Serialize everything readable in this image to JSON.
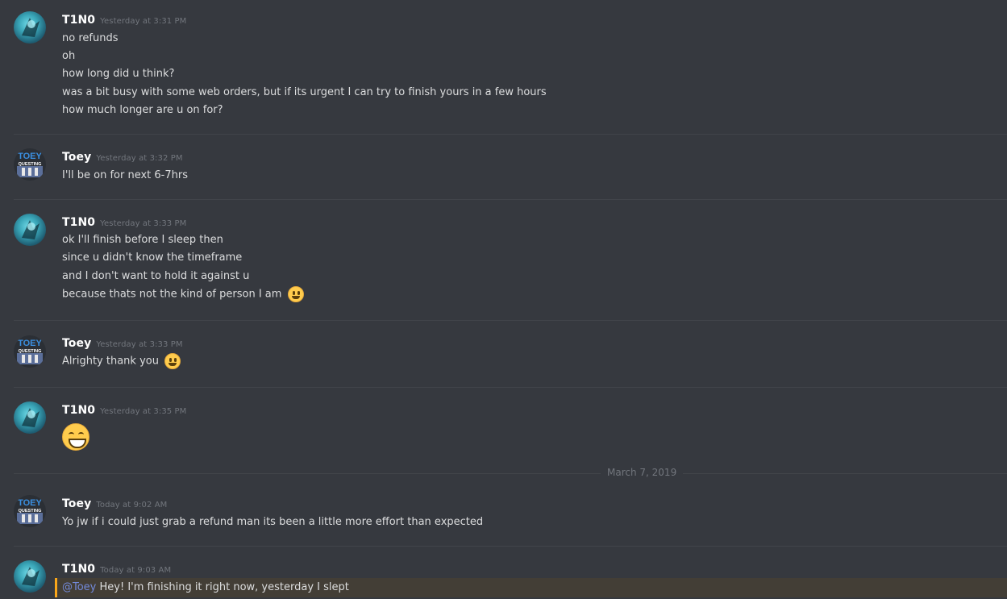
{
  "messages": [
    {
      "author": "T1N0",
      "timestamp": "Yesterday at 3:31 PM",
      "lines": [
        "no refunds",
        "oh",
        "how long did u think?",
        "was a bit busy with some web orders, but if its urgent I can try to finish yours in a few hours",
        "how much longer are u on for?"
      ]
    },
    {
      "author": "Toey",
      "timestamp": "Yesterday at 3:32 PM",
      "lines": [
        "I'll be on for next 6-7hrs"
      ]
    },
    {
      "author": "T1N0",
      "timestamp": "Yesterday at 3:33 PM",
      "lines": [
        "ok I'll finish before I sleep then",
        "since u didn't know the timeframe",
        "and I don't want to hold it against u",
        "because thats not the kind of person I am"
      ],
      "last_line_emoji": "smiley-emoji"
    },
    {
      "author": "Toey",
      "timestamp": "Yesterday at 3:33 PM",
      "lines": [
        "Alrighty thank you"
      ],
      "last_line_emoji": "smiley-emoji"
    },
    {
      "author": "T1N0",
      "timestamp": "Yesterday at 3:35 PM",
      "emoji_only": "grin-emoji"
    },
    {
      "author": "Toey",
      "timestamp": "Today at 9:02 AM",
      "lines": [
        "Yo jw if i could just grab a refund man its been a little more effort than expected"
      ]
    },
    {
      "author": "T1N0",
      "timestamp": "Today at 9:03 AM",
      "mention": "@Toey",
      "mention_text": " Hey! I'm finishing it right now, yesterday I slept"
    }
  ],
  "date_divider": "March 7, 2019",
  "avatar_toey_text": {
    "top": "TOEY",
    "middle": "QUESTING"
  },
  "colors": {
    "background": "#36393f",
    "mention_highlight": "#faa61a",
    "mention_link": "#7289da"
  }
}
